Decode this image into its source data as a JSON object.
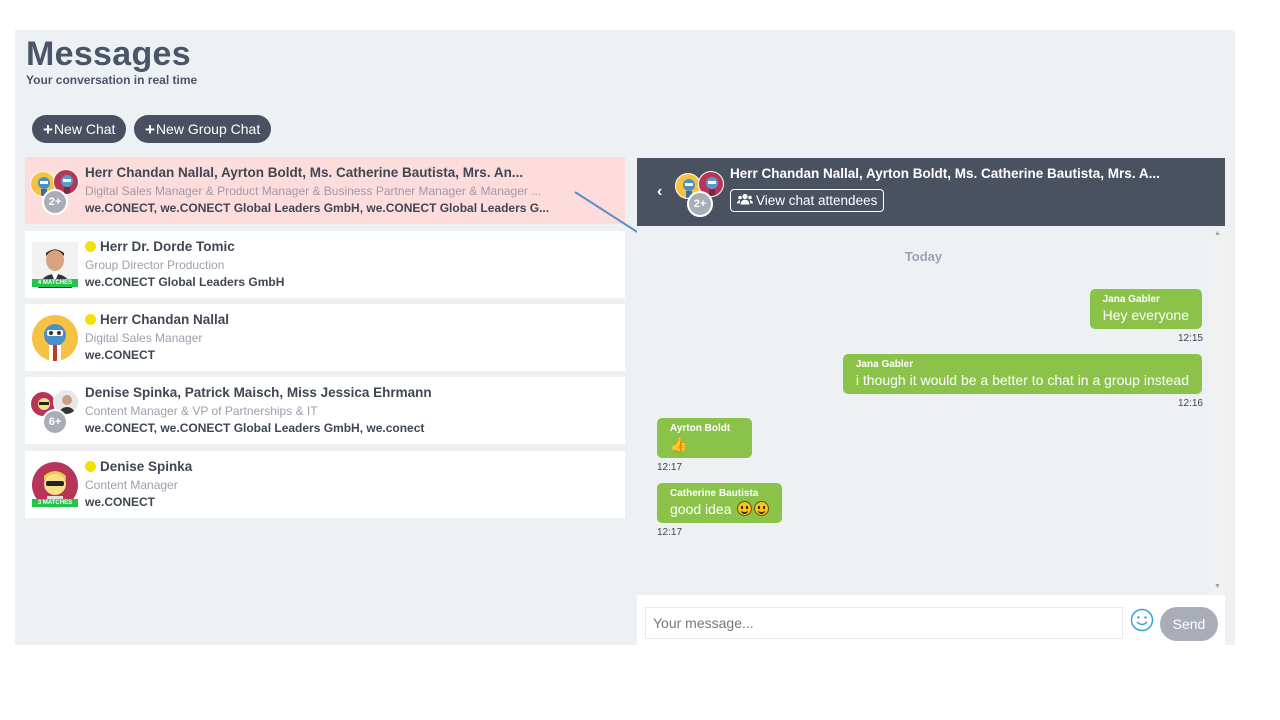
{
  "page": {
    "title": "Messages",
    "subtitle": "Your conversation in real time"
  },
  "actions": {
    "new_chat": "New Chat",
    "new_group_chat": "New Group Chat"
  },
  "chats": [
    {
      "name": "Herr Chandan Nallal, Ayrton Boldt, Ms. Catherine Bautista, Mrs. An...",
      "role": "Digital Sales Manager & Product Manager & Business Partner Manager & Manager ...",
      "company": "we.CONECT, we.CONECT Global Leaders GmbH, we.CONECT Global Leaders G...",
      "more": "2+",
      "selected": true
    },
    {
      "name": "Herr Dr. Dorde Tomic",
      "role": "Group Director Production",
      "company": "we.CONECT Global Leaders GmbH",
      "matches": "4 MATCHES",
      "online": true
    },
    {
      "name": "Herr Chandan Nallal",
      "role": "Digital Sales Manager",
      "company": "we.CONECT",
      "online": true
    },
    {
      "name": "Denise Spinka, Patrick Maisch, Miss Jessica Ehrmann",
      "role": "Content Manager & VP of Partnerships & IT",
      "company": "we.CONECT, we.CONECT Global Leaders GmbH, we.conect",
      "more": "6+"
    },
    {
      "name": "Denise Spinka",
      "role": "Content Manager",
      "company": "we.CONECT",
      "matches": "3 MATCHES",
      "online": true
    }
  ],
  "conversation": {
    "title": "Herr Chandan Nallal, Ayrton Boldt, Ms. Catherine Bautista, Mrs. A...",
    "more": "2+",
    "attendees_button": "View chat attendees",
    "day_label": "Today",
    "messages": [
      {
        "sender": "Jana Gabler",
        "text": "Hey everyone",
        "time": "12:15",
        "own": true
      },
      {
        "sender": "Jana Gabler",
        "text": "i though it would be a better to chat in a group instead",
        "time": "12:16",
        "own": true
      },
      {
        "sender": "Ayrton Boldt",
        "text": "👍",
        "time": "12:17",
        "own": false
      },
      {
        "sender": "Catherine Bautista",
        "text": "good idea",
        "time": "12:17",
        "own": false
      }
    ]
  },
  "composer": {
    "placeholder": "Your message...",
    "send": "Send"
  },
  "colors": {
    "accent": "#8bc34a",
    "header": "#4a5262",
    "selected": "#fddcdc",
    "online": "#f2e200",
    "matches": "#23c44a"
  }
}
